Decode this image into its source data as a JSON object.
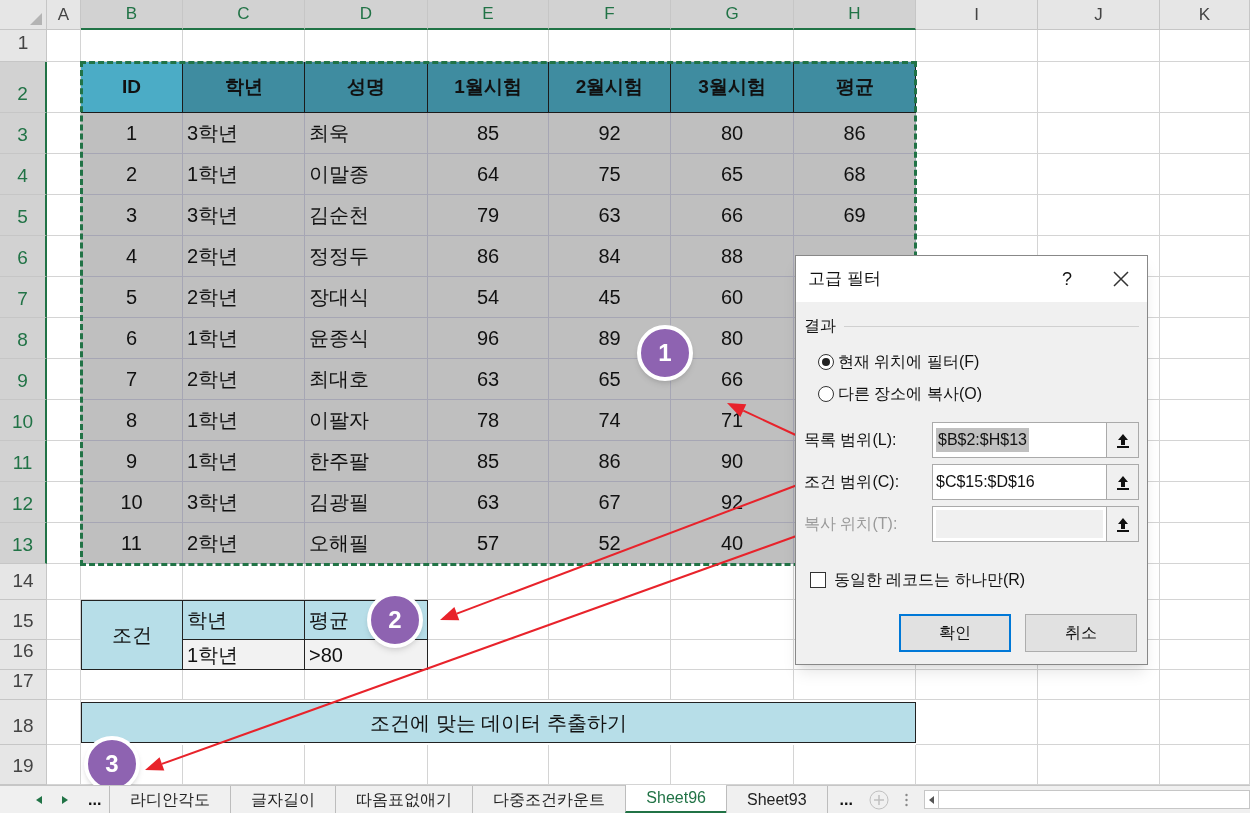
{
  "columns": [
    {
      "label": "A",
      "selected": false
    },
    {
      "label": "B",
      "selected": true
    },
    {
      "label": "C",
      "selected": true
    },
    {
      "label": "D",
      "selected": true
    },
    {
      "label": "E",
      "selected": true
    },
    {
      "label": "F",
      "selected": true
    },
    {
      "label": "G",
      "selected": true
    },
    {
      "label": "H",
      "selected": true
    },
    {
      "label": "I",
      "selected": false
    },
    {
      "label": "J",
      "selected": false
    },
    {
      "label": "K",
      "selected": false
    }
  ],
  "row_numbers": [
    {
      "label": "1",
      "selected": false
    },
    {
      "label": "2",
      "selected": true
    },
    {
      "label": "3",
      "selected": true
    },
    {
      "label": "4",
      "selected": true
    },
    {
      "label": "5",
      "selected": true
    },
    {
      "label": "6",
      "selected": true
    },
    {
      "label": "7",
      "selected": true
    },
    {
      "label": "8",
      "selected": true
    },
    {
      "label": "9",
      "selected": true
    },
    {
      "label": "10",
      "selected": true
    },
    {
      "label": "11",
      "selected": true
    },
    {
      "label": "12",
      "selected": true
    },
    {
      "label": "13",
      "selected": true
    },
    {
      "label": "14",
      "selected": false
    },
    {
      "label": "15",
      "selected": false
    },
    {
      "label": "16",
      "selected": false
    },
    {
      "label": "17",
      "selected": false
    },
    {
      "label": "18",
      "selected": false
    },
    {
      "label": "19",
      "selected": false
    }
  ],
  "table": {
    "header": [
      "ID",
      "학년",
      "성명",
      "1월시험",
      "2월시험",
      "3월시험",
      "평균"
    ],
    "rows": [
      [
        "1",
        "3학년",
        "최욱",
        "85",
        "92",
        "80",
        "86"
      ],
      [
        "2",
        "1학년",
        "이말종",
        "64",
        "75",
        "65",
        "68"
      ],
      [
        "3",
        "3학년",
        "김순천",
        "79",
        "63",
        "66",
        "69"
      ],
      [
        "4",
        "2학년",
        "정정두",
        "86",
        "84",
        "88"
      ],
      [
        "5",
        "2학년",
        "장대식",
        "54",
        "45",
        "60"
      ],
      [
        "6",
        "1학년",
        "윤종식",
        "96",
        "89",
        "80"
      ],
      [
        "7",
        "2학년",
        "최대호",
        "63",
        "65",
        "66"
      ],
      [
        "8",
        "1학년",
        "이팔자",
        "78",
        "74",
        "71"
      ],
      [
        "9",
        "1학년",
        "한주팔",
        "85",
        "86",
        "90"
      ],
      [
        "10",
        "3학년",
        "김광필",
        "63",
        "67",
        "92"
      ],
      [
        "11",
        "2학년",
        "오해필",
        "57",
        "52",
        "40"
      ]
    ]
  },
  "criteria": {
    "label": "조건",
    "headers": [
      "학년",
      "평균"
    ],
    "values": [
      "1학년",
      ">80"
    ]
  },
  "action_cell": "조건에 맞는 데이터 추출하기",
  "markers": [
    "1",
    "2",
    "3"
  ],
  "dialog": {
    "title": "고급 필터",
    "help": "?",
    "section": "결과",
    "radios": [
      {
        "label": "현재 위치에 필터(F)",
        "selected": true
      },
      {
        "label": "다른 장소에 복사(O)",
        "selected": false
      }
    ],
    "fields": [
      {
        "label": "목록 범위(L):",
        "value": "$B$2:$H$13",
        "disabled": false,
        "highlighted": true
      },
      {
        "label": "조건 범위(C):",
        "value": "$C$15:$D$16",
        "disabled": false,
        "highlighted": false
      },
      {
        "label": "복사 위치(T):",
        "disabled": true
      }
    ],
    "checkbox": {
      "label": "동일한 레코드는 하나만(R)",
      "checked": false
    },
    "buttons": [
      {
        "label": "확인",
        "default": true
      },
      {
        "label": "취소",
        "default": false
      }
    ]
  },
  "sheet_tabs": {
    "more_left": "...",
    "tabs": [
      {
        "label": "라디안각도",
        "selected": false
      },
      {
        "label": "글자길이",
        "selected": false
      },
      {
        "label": "따옴표없애기",
        "selected": false
      },
      {
        "label": "다중조건카운트",
        "selected": false
      },
      {
        "label": "Sheet96",
        "selected": true
      },
      {
        "label": "Sheet93",
        "selected": false
      }
    ],
    "more_right": "..."
  }
}
